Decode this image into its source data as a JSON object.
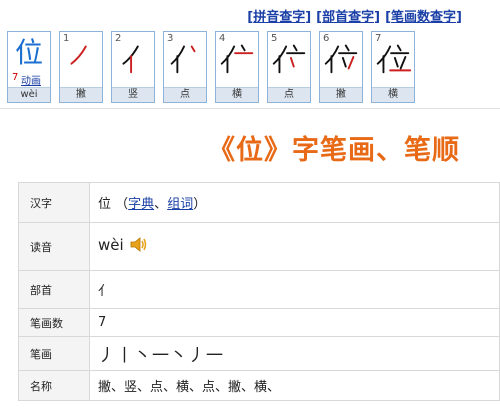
{
  "nav": {
    "links": [
      {
        "label": "拼音查字"
      },
      {
        "label": "部首查字"
      },
      {
        "label": "笔画数查字"
      }
    ]
  },
  "strokes_panel": {
    "char": "位",
    "count": "7",
    "animate_label": "动画",
    "pinyin": "wèi",
    "steps": [
      {
        "n": "1",
        "glyph": "丿",
        "name": "撇"
      },
      {
        "n": "2",
        "glyph": "亻",
        "name": "竖"
      },
      {
        "n": "3",
        "glyph": "亻丶",
        "name": "点"
      },
      {
        "n": "4",
        "glyph": "亻亠",
        "name": "横"
      },
      {
        "n": "5",
        "glyph": "亻亠",
        "name": "点"
      },
      {
        "n": "6",
        "glyph": "亻立",
        "name": "撇"
      },
      {
        "n": "7",
        "glyph": "位",
        "name": "横"
      }
    ]
  },
  "title": "《位》字笔画、笔顺",
  "info": {
    "rows": [
      {
        "key": "汉字",
        "char": "位",
        "links": [
          "字典",
          "组词"
        ]
      },
      {
        "key": "读音",
        "value": "wèi"
      },
      {
        "key": "部首",
        "value": "亻"
      },
      {
        "key": "笔画数",
        "value": "7"
      },
      {
        "key": "笔画",
        "value": "丿丨丶一丶丿一"
      },
      {
        "key": "名称",
        "value": "撇、竖、点、横、点、撇、横、"
      }
    ]
  },
  "colors": {
    "link": "#1a3fa6",
    "title": "#e86a17",
    "card_border": "#8fb3d8",
    "card_foot": "#dde6f0",
    "count_red": "#d00000"
  }
}
